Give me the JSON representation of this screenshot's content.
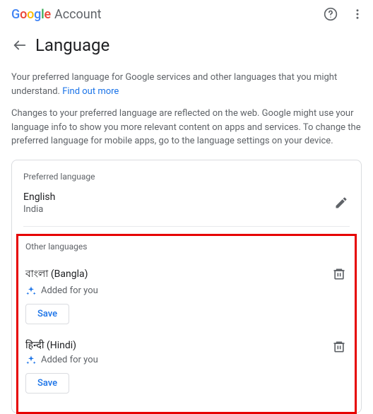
{
  "header": {
    "logo_account": "Account"
  },
  "page": {
    "title": "Language",
    "desc1_part1": "Your preferred language for Google services and other languages that you might understand. ",
    "desc1_link": "Find out more",
    "desc2": "Changes to your preferred language are reflected on the web. Google might use your language info to show you more relevant content on apps and services. To change the preferred language for mobile apps, go to the language settings on your device."
  },
  "card": {
    "preferred_label": "Preferred language",
    "preferred_lang": "English",
    "preferred_region": "India",
    "other_label": "Other languages",
    "items": [
      {
        "name": "বাংলা (Bangla)",
        "added": "Added for you",
        "save": "Save"
      },
      {
        "name": "हिन्दी (Hindi)",
        "added": "Added for you",
        "save": "Save"
      }
    ]
  }
}
